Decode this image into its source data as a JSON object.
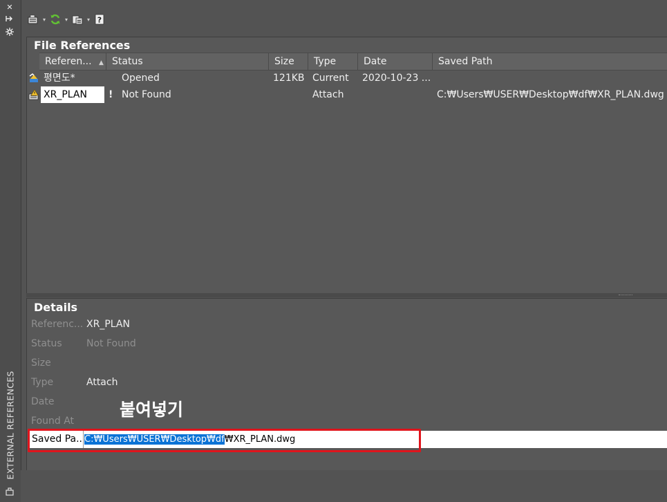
{
  "window": {
    "vertical_title": "EXTERNAL REFERENCES",
    "controls": [
      "close-icon",
      "auto-hide-icon",
      "properties-icon"
    ]
  },
  "toolbar": {
    "buttons": [
      "attach-dwg-icon",
      "refresh-icon",
      "change-path-icon",
      "help-icon"
    ]
  },
  "file_references": {
    "title": "File References",
    "columns": [
      "Referen...",
      "Status",
      "Size",
      "Type",
      "Date",
      "Saved Path"
    ],
    "rows": [
      {
        "name": "평면도*",
        "status": "Opened",
        "size": "121KB",
        "type": "Current",
        "date": "2020-10-23 ...",
        "saved_path": ""
      },
      {
        "name": "XR_PLAN",
        "status": "Not Found",
        "status_flag": "!",
        "size": "",
        "type": "Attach",
        "date": "",
        "saved_path": "C:₩Users₩USER₩Desktop₩df₩XR_PLAN.dwg"
      }
    ]
  },
  "details": {
    "title": "Details",
    "rows": [
      {
        "label": "Referenc...",
        "value": "XR_PLAN"
      },
      {
        "label": "Status",
        "value": "Not Found"
      },
      {
        "label": "Size",
        "value": ""
      },
      {
        "label": "Type",
        "value": "Attach"
      },
      {
        "label": "Date",
        "value": ""
      },
      {
        "label": "Found At",
        "value": ""
      }
    ],
    "saved_path_label": "Saved Pa...",
    "saved_path_selected": "C:₩Users₩USER₩Desktop₩df",
    "saved_path_rest": "₩XR_PLAN.dwg"
  },
  "annotation": {
    "caption": "붙여넣기",
    "highlight_color": "#e0141c"
  },
  "colors": {
    "background": "#535353",
    "selection": "#0b73d6"
  }
}
